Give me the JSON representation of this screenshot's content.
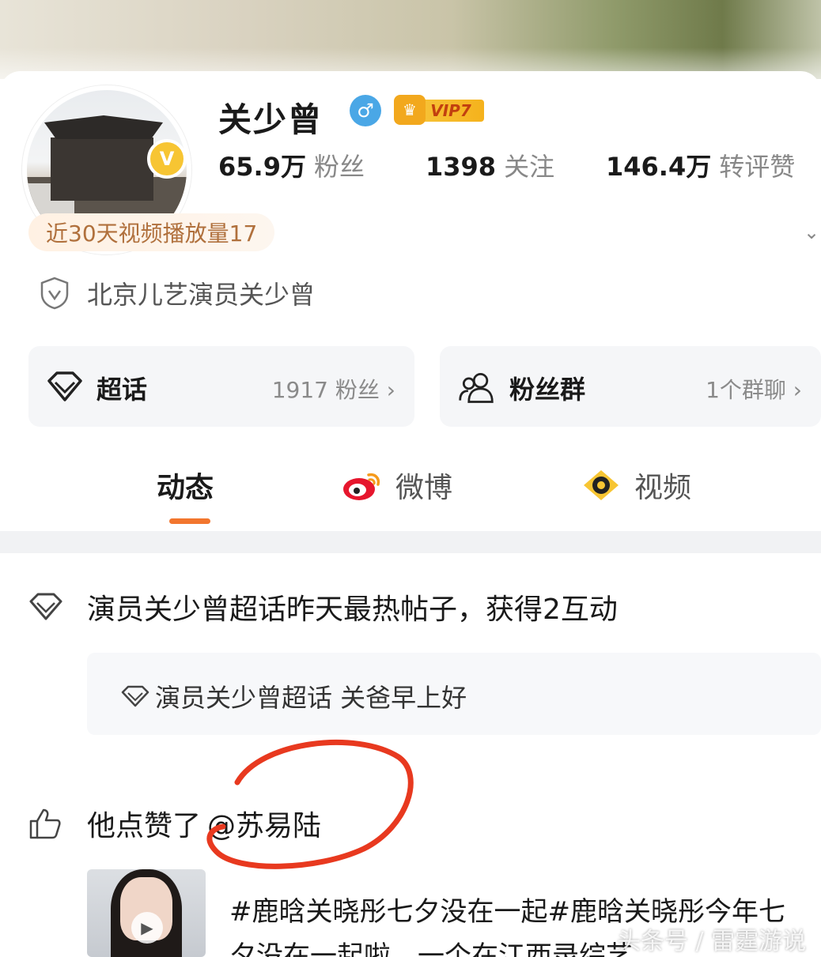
{
  "profile": {
    "name": "关少曾",
    "vip_label": "VIP7",
    "v_badge": "V",
    "gender_symbol": "♂"
  },
  "stats": [
    {
      "value": "65.9万",
      "label": "粉丝"
    },
    {
      "value": "1398",
      "label": "关注"
    },
    {
      "value": "146.4万",
      "label": "转评赞"
    }
  ],
  "play_count_label": "近30天视频播放量17",
  "verification": "北京儿艺演员关少曾",
  "supertopic": {
    "title": "超话",
    "meta": "1917 粉丝 ›"
  },
  "fan_group": {
    "title": "粉丝群",
    "meta": "1个群聊 ›"
  },
  "tabs": [
    {
      "label": "动态"
    },
    {
      "label": "微博"
    },
    {
      "label": "视频"
    }
  ],
  "feed": {
    "hot_post": "演员关少曾超话昨天最热帖子，获得2互动",
    "quote": "演员关少曾超话 关爸早上好",
    "like_action": "他点赞了",
    "like_target": "@苏易陆",
    "post_text": "#鹿晗关晓彤七夕没在一起#鹿晗关晓彤今年七夕没在一起啦，一个在江西录综艺",
    "watermark": "头条号 / 雷霆游说"
  },
  "colors": {
    "accent": "#f2762e",
    "vip_gold": "#f5b21c",
    "gender_blue": "#4aa7e6",
    "circle_red": "#e8391f"
  }
}
